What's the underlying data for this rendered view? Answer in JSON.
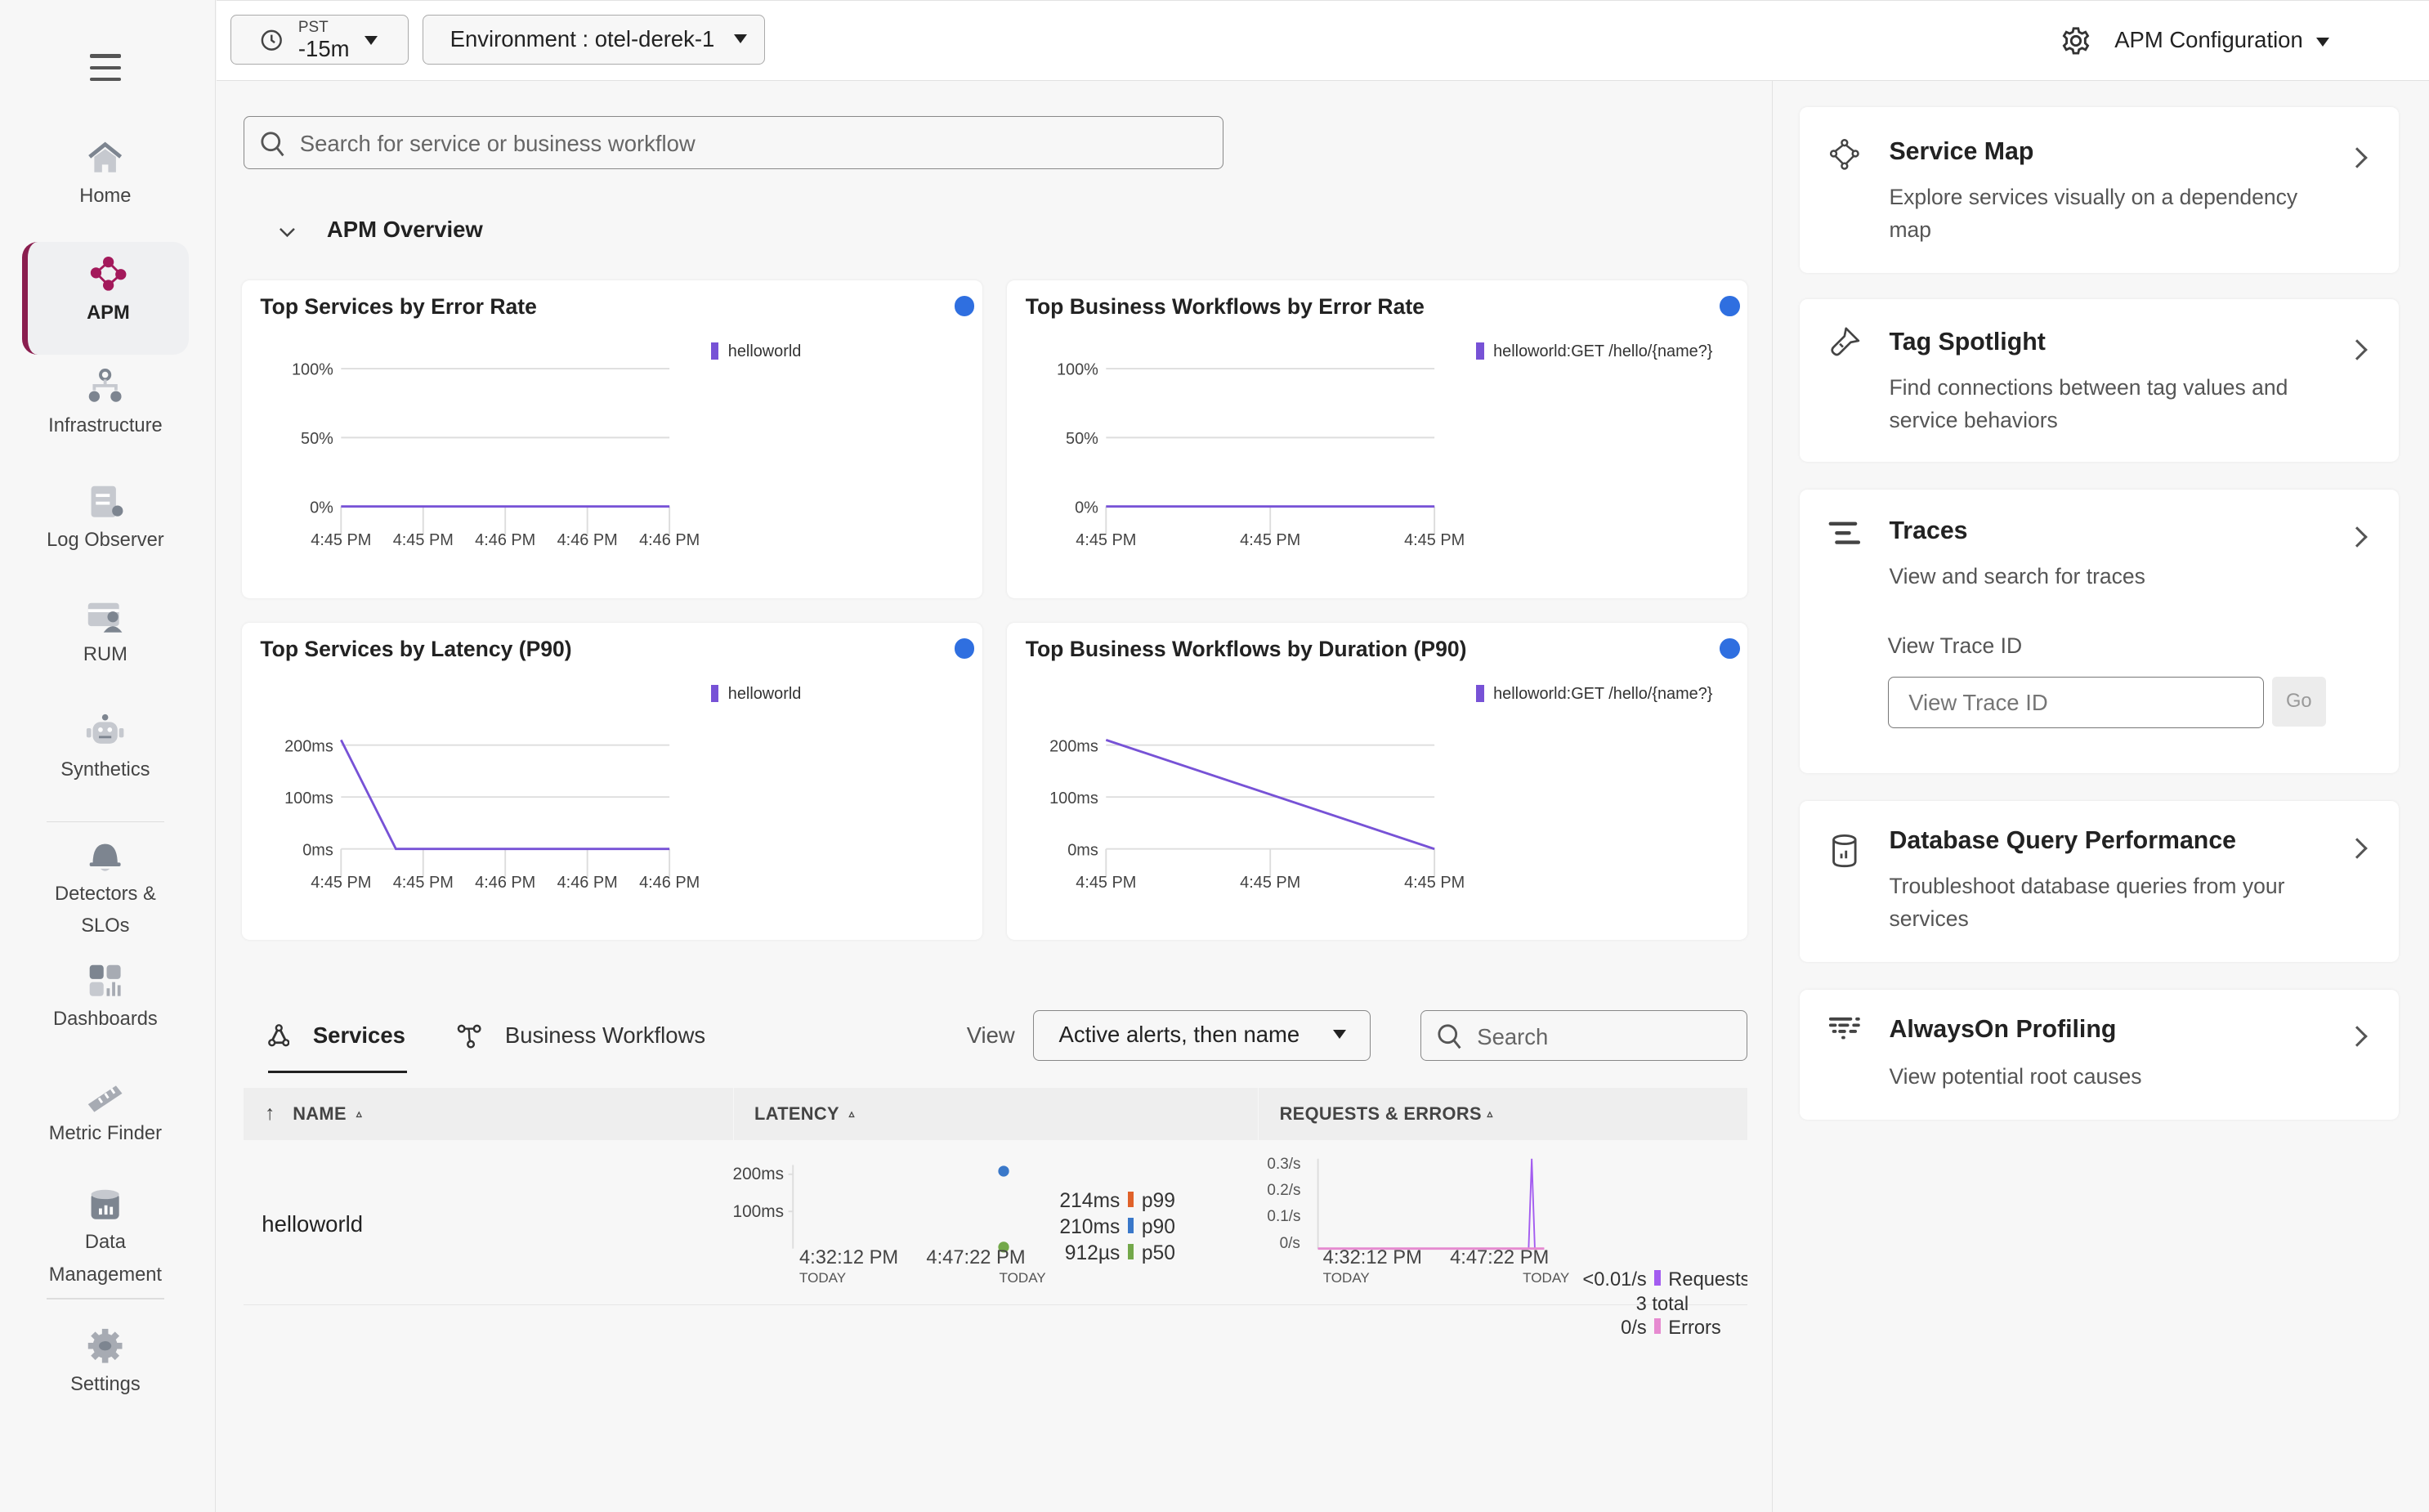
{
  "sidebar": {
    "menu_icon": "hamburger-icon",
    "items": [
      {
        "label": "Home",
        "icon": "home-icon",
        "active": false
      },
      {
        "label": "APM",
        "icon": "apm-icon",
        "active": true
      },
      {
        "label": "Infrastructure",
        "icon": "infrastructure-icon",
        "active": false
      },
      {
        "label": "Log Observer",
        "icon": "log-icon",
        "active": false
      },
      {
        "label": "RUM",
        "icon": "rum-icon",
        "active": false
      },
      {
        "label": "Synthetics",
        "icon": "robot-icon",
        "active": false
      },
      {
        "label": "Detectors & SLOs",
        "label_line1": "Detectors &",
        "label_line2": "SLOs",
        "icon": "bell-icon",
        "active": false
      },
      {
        "label": "Dashboards",
        "icon": "dashboard-icon",
        "active": false
      },
      {
        "label": "Metric Finder",
        "icon": "ruler-icon",
        "active": false
      },
      {
        "label": "Data Management",
        "label_line1": "Data",
        "label_line2": "Management",
        "icon": "database-icon",
        "active": false
      },
      {
        "label": "Settings",
        "icon": "gear-icon",
        "active": false
      }
    ],
    "accent_color": "#8a1e4f"
  },
  "topbar": {
    "timezone": "PST",
    "time_range": "-15m",
    "environment_label": "Environment : otel-derek-1",
    "config_label": "APM Configuration"
  },
  "main": {
    "search_placeholder": "Search for service or business workflow",
    "overview_title": "APM Overview",
    "cards": [
      {
        "title": "Top Services by Error Rate"
      },
      {
        "title": "Top Business Workflows by Error Rate"
      },
      {
        "title": "Top Services by Latency (P90)"
      },
      {
        "title": "Top Business Workflows by Duration (P90)"
      }
    ],
    "tabs": [
      {
        "label": "Services",
        "active": true
      },
      {
        "label": "Business Workflows",
        "active": false
      }
    ],
    "view_label": "View",
    "view_select": "Active alerts, then name",
    "table_search_placeholder": "Search",
    "table": {
      "headers": [
        "NAME",
        "LATENCY",
        "REQUESTS & ERRORS"
      ],
      "rows": [
        {
          "name": "helloworld",
          "latency": {
            "y_ticks": [
              "200ms",
              "100ms"
            ],
            "x_start": "4:32:12 PM",
            "x_end": "4:47:22 PM",
            "day_label": "TODAY",
            "p99": "214ms",
            "p90": "210ms",
            "p50": "912µs",
            "p99_label": "p99",
            "p90_label": "p90",
            "p50_label": "p50"
          },
          "requests": {
            "y_ticks": [
              "0.3/s",
              "0.2/s",
              "0.1/s",
              "0/s"
            ],
            "x_start": "4:32:12 PM",
            "x_end": "4:47:22 PM",
            "day_label": "TODAY",
            "requests_rate": "<0.01/s",
            "requests_label": "Requests",
            "total_count": "3",
            "total_label": "total",
            "errors_rate": "0/s",
            "errors_label": "Errors"
          }
        }
      ]
    }
  },
  "right_panel": {
    "cards": [
      {
        "title": "Service Map",
        "description": "Explore services visually on a dependency map",
        "icon": "service-map-icon"
      },
      {
        "title": "Tag Spotlight",
        "description": "Find connections between tag values and service behaviors",
        "icon": "flashlight-icon"
      },
      {
        "title": "Traces",
        "description": "View and search for traces",
        "icon": "traces-icon",
        "trace_id_label": "View Trace ID",
        "trace_id_placeholder": "View Trace ID",
        "go_label": "Go"
      },
      {
        "title": "Database Query Performance",
        "description": "Troubleshoot database queries from your services",
        "icon": "database-icon"
      },
      {
        "title": "AlwaysOn Profiling",
        "description": "View potential root causes",
        "icon": "profiling-icon"
      }
    ]
  },
  "colors": {
    "series": "#7752d6",
    "status_dot": "#2f6fe0",
    "p99": "#e0622a",
    "p90": "#3a78c9",
    "p50": "#73a84a",
    "requests": "#a35cf0",
    "errors": "#e68ad0"
  },
  "chart_data": [
    {
      "type": "line",
      "title": "Top Services by Error Rate",
      "x": [
        "4:45 PM",
        "4:45 PM",
        "4:46 PM",
        "4:46 PM",
        "4:46 PM"
      ],
      "series": [
        {
          "name": "helloworld",
          "values": [
            0,
            0,
            0,
            0,
            0
          ]
        }
      ],
      "y_ticks": [
        "0%",
        "50%",
        "100%"
      ],
      "ylim": [
        0,
        100
      ],
      "legend": "top-right",
      "grid": true
    },
    {
      "type": "line",
      "title": "Top Business Workflows by Error Rate",
      "x": [
        "4:45 PM",
        "4:45 PM",
        "4:45 PM"
      ],
      "series": [
        {
          "name": "helloworld:GET /hello/{name?}",
          "values": [
            0,
            0,
            0
          ]
        }
      ],
      "y_ticks": [
        "0%",
        "50%",
        "100%"
      ],
      "ylim": [
        0,
        100
      ],
      "legend": "top-right",
      "grid": true
    },
    {
      "type": "line",
      "title": "Top Services by Latency (P90)",
      "x": [
        "4:45 PM",
        "4:45 PM",
        "4:46 PM",
        "4:46 PM",
        "4:46 PM"
      ],
      "series": [
        {
          "name": "helloworld",
          "points": [
            [
              0,
              210
            ],
            [
              0.167,
              0
            ],
            [
              1,
              0
            ]
          ]
        }
      ],
      "y_ticks": [
        "0ms",
        "100ms",
        "200ms"
      ],
      "ylim": [
        0,
        200
      ],
      "legend": "top-right",
      "grid": true
    },
    {
      "type": "line",
      "title": "Top Business Workflows by Duration (P90)",
      "x": [
        "4:45 PM",
        "4:45 PM",
        "4:45 PM"
      ],
      "series": [
        {
          "name": "helloworld:GET /hello/{name?}",
          "points": [
            [
              0,
              210
            ],
            [
              1,
              0
            ]
          ]
        }
      ],
      "y_ticks": [
        "0ms",
        "100ms",
        "200ms"
      ],
      "ylim": [
        0,
        200
      ],
      "legend": "top-right",
      "grid": true
    }
  ]
}
